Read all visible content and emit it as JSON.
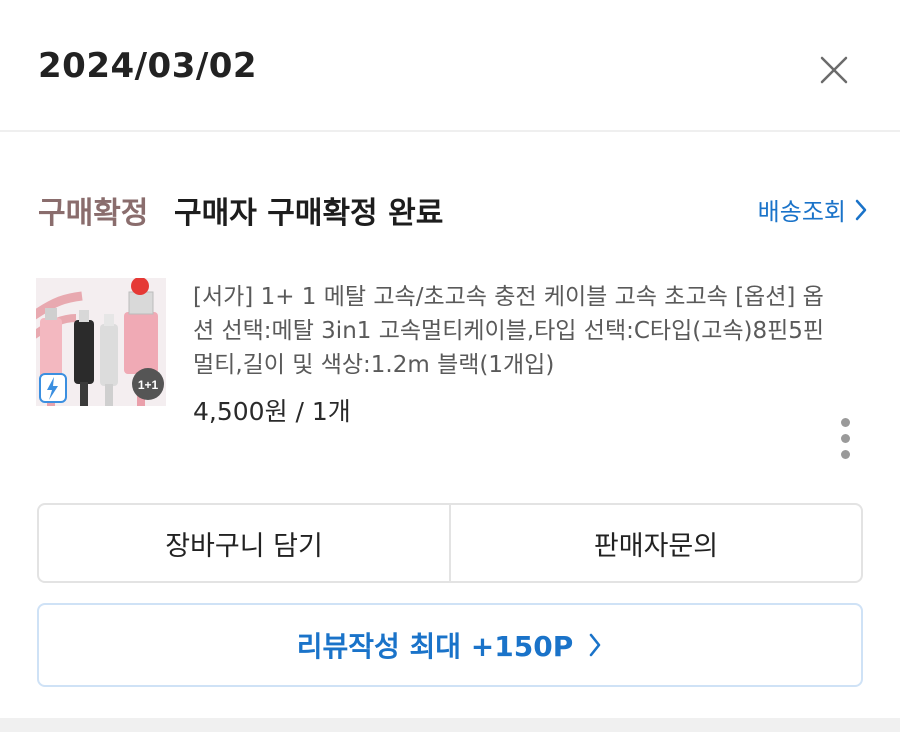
{
  "header": {
    "date": "2024/03/02",
    "close_icon": "close-icon"
  },
  "order": {
    "status_label": "구매확정",
    "status_text": "구매자 구매확정 완료",
    "track_link": "배송조회",
    "track_icon": "chevron-right-icon"
  },
  "product": {
    "thumbnail_alt": "product-thumbnail",
    "thumbnail_text": {
      "badge": "1+1",
      "tag": "1+1"
    },
    "description": "[서가] 1+ 1 메탈 고속/초고속 충전 케이블 고속 초고속 [옵션] 옵션 선택:메탈 3in1 고속멀티케이블,타입 선택:C타입(고속)8핀5핀 멀티,길이 및 색상:1.2m 블랙(1개입)",
    "price": "4,500원 / 1개",
    "more_icon": "more-vertical-icon"
  },
  "actions": {
    "cart_label": "장바구니 담기",
    "inquiry_label": "판매자문의",
    "review_label": "리뷰작성 최대 +150P",
    "review_icon": "chevron-right-icon"
  },
  "colors": {
    "accent": "#1a73c9",
    "status": "#8a6d6d",
    "border": "#e3e3e3",
    "review_border": "#cfe2f6"
  }
}
